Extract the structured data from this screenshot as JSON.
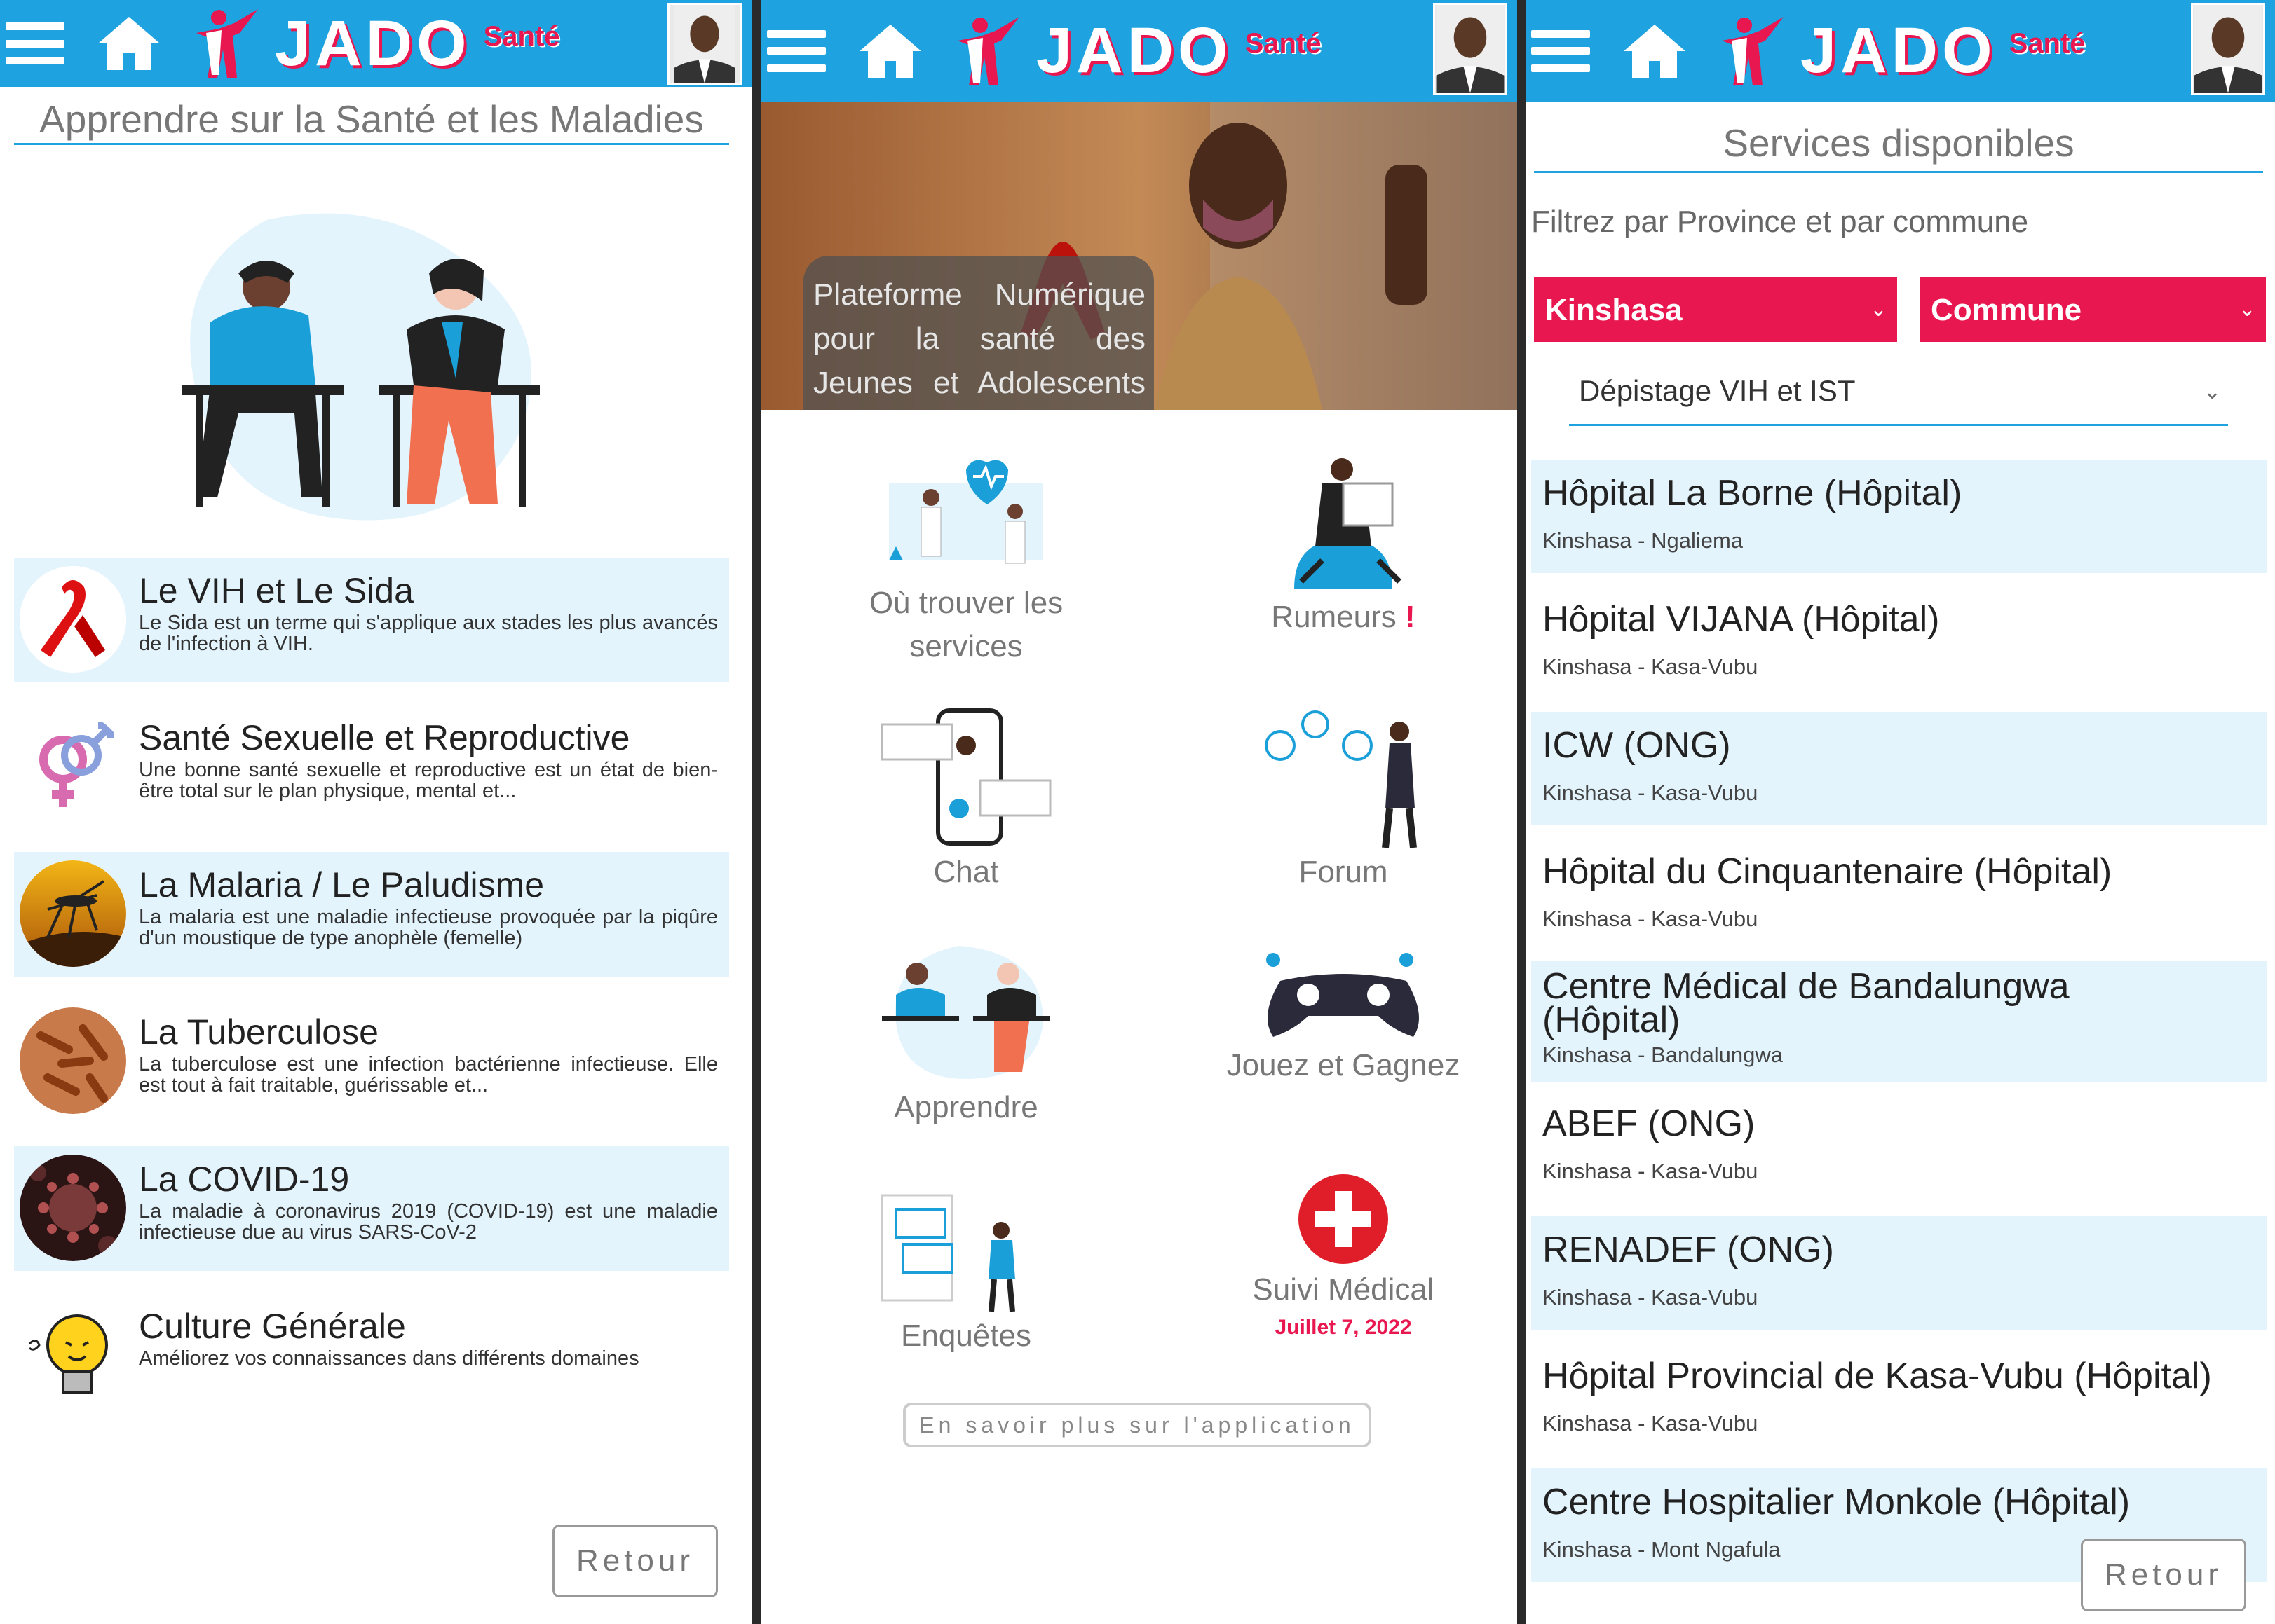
{
  "header": {
    "logo_word": "JADO",
    "logo_sub": "Santé"
  },
  "learn": {
    "title": "Apprendre sur la Santé et les Maladies",
    "topics": [
      {
        "title": "Le VIH et Le Sida",
        "desc": "Le Sida est un terme qui s'applique aux stades les plus avancés de l'infection à VIH."
      },
      {
        "title": "Santé Sexuelle et Reproductive",
        "desc": "Une bonne santé sexuelle et reproductive est un état de bien-être total sur le plan physique, mental et..."
      },
      {
        "title": "La Malaria / Le Paludisme",
        "desc": "La malaria est une maladie infectieuse provoquée par la piqûre d'un moustique de type anophèle (femelle)"
      },
      {
        "title": "La Tuberculose",
        "desc": "La tuberculose est une infection bactérienne infectieuse. Elle est tout à fait traitable, guérissable et..."
      },
      {
        "title": "La COVID-19",
        "desc": "La maladie à coronavirus 2019 (COVID-19) est une maladie infectieuse due au virus SARS-CoV-2"
      },
      {
        "title": "Culture Générale",
        "desc": "Améliorez vos connaissances dans différents domaines"
      }
    ],
    "back_label": "Retour"
  },
  "home": {
    "banner_text": "Plateforme Numérique pour la santé des Jeunes et Adolescents en RDC.",
    "tiles": {
      "services": "Où trouver les services",
      "rumeurs": "Rumeurs",
      "rumeurs_mark": "!",
      "chat": "Chat",
      "forum": "Forum",
      "apprendre": "Apprendre",
      "jouez": "Jouez et Gagnez",
      "enquetes": "Enquêtes",
      "suivi": "Suivi Médical",
      "suivi_date": "Juillet 7, 2022"
    },
    "more_label": "En savoir plus sur l'application"
  },
  "services": {
    "title": "Services disponibles",
    "filter_label": "Filtrez par Province et par commune",
    "province": "Kinshasa",
    "commune": "Commune",
    "service_type": "Dépistage VIH et IST",
    "items": [
      {
        "name": "Hôpital La Borne (Hôpital)",
        "loc": "Kinshasa - Ngaliema"
      },
      {
        "name": "Hôpital VIJANA (Hôpital)",
        "loc": "Kinshasa - Kasa-Vubu"
      },
      {
        "name": "ICW (ONG)",
        "loc": "Kinshasa - Kasa-Vubu"
      },
      {
        "name": "Hôpital du Cinquantenaire (Hôpital)",
        "loc": "Kinshasa - Kasa-Vubu"
      },
      {
        "name": "Centre Médical de Bandalungwa (Hôpital)",
        "loc": "Kinshasa - Bandalungwa"
      },
      {
        "name": "ABEF (ONG)",
        "loc": "Kinshasa - Kasa-Vubu"
      },
      {
        "name": "RENADEF (ONG)",
        "loc": "Kinshasa - Kasa-Vubu"
      },
      {
        "name": "Hôpital Provincial de Kasa-Vubu (Hôpital)",
        "loc": "Kinshasa - Kasa-Vubu"
      },
      {
        "name": "Centre Hospitalier Monkole (Hôpital)",
        "loc": "Kinshasa - Mont Ngafula"
      }
    ],
    "back_label": "Retour"
  }
}
